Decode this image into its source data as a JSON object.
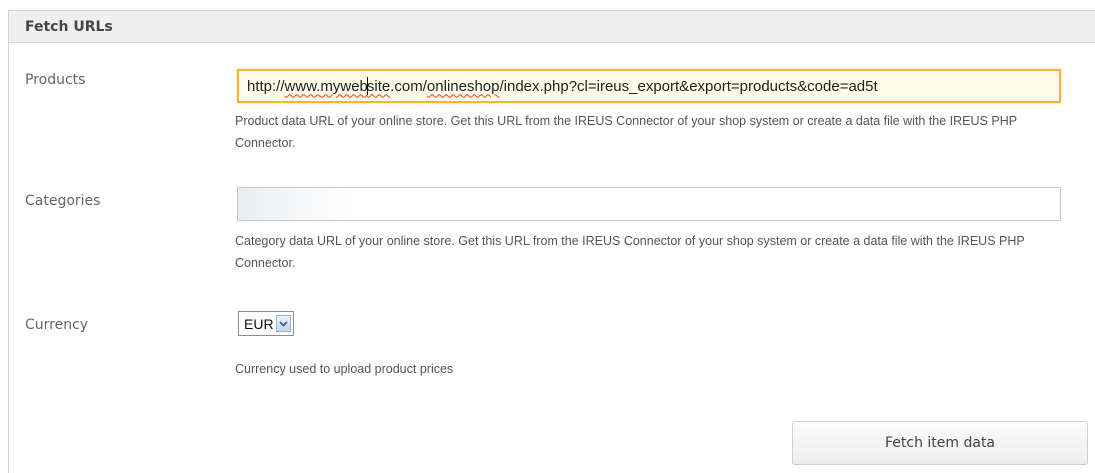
{
  "panel": {
    "title": "Fetch URLs"
  },
  "products": {
    "label": "Products",
    "url_parts": [
      "http://",
      "www.",
      "myweb",
      "site",
      ".com/",
      "onlineshop",
      "/index.php?cl=ireus_export&export=products&code=ad5t"
    ],
    "help": "Product data URL of your online store. Get this URL from the IREUS Connector of your shop system or create a data file with the IREUS PHP Connector."
  },
  "categories": {
    "label": "Categories",
    "value": "",
    "help": "Category data URL of your online store. Get this URL from the IREUS Connector of your shop system or create a data file with the IREUS PHP Connector."
  },
  "currency": {
    "label": "Currency",
    "selected": "EUR",
    "help": "Currency used to upload product prices"
  },
  "actions": {
    "fetch_label": "Fetch item data"
  },
  "colors": {
    "focus_border": "#f2b347",
    "header_bg": "#efefef"
  },
  "icons": {
    "select_arrow": "chevron-down-icon"
  }
}
